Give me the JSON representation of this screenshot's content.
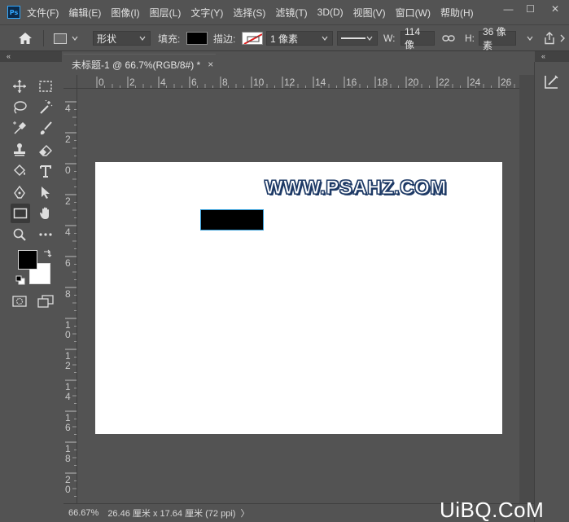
{
  "menubar": {
    "app_icon_label": "Ps",
    "items": [
      "文件(F)",
      "编辑(E)",
      "图像(I)",
      "图层(L)",
      "文字(Y)",
      "选择(S)",
      "滤镜(T)",
      "3D(D)",
      "视图(V)",
      "窗口(W)",
      "帮助(H)"
    ]
  },
  "window_controls": {
    "minimize": "—",
    "maximize": "☐",
    "close": "✕"
  },
  "options": {
    "home_icon": "home-icon",
    "mode": "形状",
    "fill_label": "填充:",
    "fill_color": "#000000",
    "stroke_label": "描边:",
    "stroke_width": "1 像素",
    "w_label": "W:",
    "w_value": "114 像",
    "h_label": "H:",
    "h_value": "36 像素"
  },
  "collapse": {
    "left": "«",
    "right": "«"
  },
  "document": {
    "tab_title": "未标题-1 @ 66.7%(RGB/8#) *",
    "tab_close": "×",
    "ruler_top": [
      "0",
      "2",
      "4",
      "6",
      "8",
      "10",
      "12",
      "14",
      "16",
      "18",
      "20",
      "22",
      "24",
      "26"
    ],
    "ruler_left": [
      "4",
      "2",
      "0",
      "2",
      "4",
      "6",
      "8",
      "1\n0",
      "1\n2",
      "1\n4",
      "1\n6",
      "1\n8",
      "2\n0"
    ],
    "watermark": "WWW.PSAHZ.COM",
    "canvas_color": "#ffffff",
    "shape_color": "#000000"
  },
  "status": {
    "zoom": "66.67%",
    "doc_size": "26.46 厘米 x 17.64 厘米 (72 ppi)",
    "arrow": "〉"
  },
  "site_logo": "UiBQ.CoM",
  "colors": {
    "foreground": "#000000",
    "background": "#ffffff",
    "accent": "#31a8ff"
  }
}
